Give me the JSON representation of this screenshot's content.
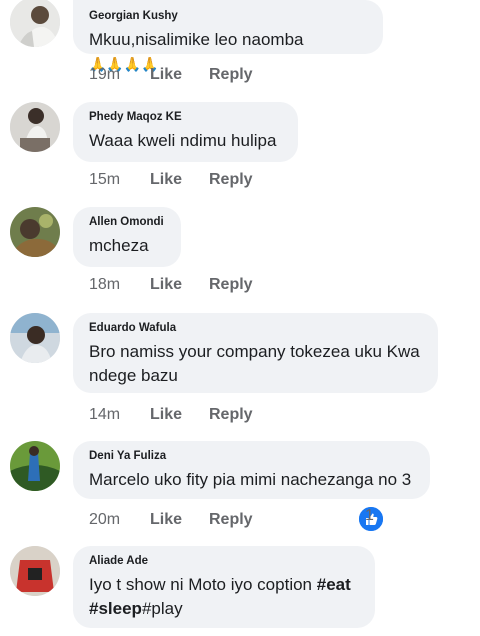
{
  "comments": [
    {
      "name": "Georgian Kushy",
      "text": "Mkuu,nisalimike leo naomba",
      "emoji": "🙏🙏🙏🙏",
      "time": "19m",
      "like_label": "Like",
      "reply_label": "Reply"
    },
    {
      "name": "Phedy Maqoz KE",
      "text": "Waaa kweli ndimu hulipa",
      "time": "15m",
      "like_label": "Like",
      "reply_label": "Reply"
    },
    {
      "name": "Allen Omondi",
      "text": "mcheza",
      "time": "18m",
      "like_label": "Like",
      "reply_label": "Reply"
    },
    {
      "name": "Eduardo Wafula",
      "text_line1": "Bro namiss your company tokezea uku Kwa",
      "text_line2": "ndege bazu",
      "time": "14m",
      "like_label": "Like",
      "reply_label": "Reply"
    },
    {
      "name": "Deni Ya Fuliza",
      "text": "Marcelo uko fity pia mimi nachezanga no 3",
      "time": "20m",
      "like_label": "Like",
      "reply_label": "Reply",
      "reaction_count": "1",
      "reaction_icon": "like-reaction-icon"
    },
    {
      "name": "Aliade Ade",
      "text_line1_plain": "Iyo t show ni Moto iyo coption ",
      "text_line1_tag": "#eat",
      "text_line2_tag": "#sleep",
      "text_line2_plain": "#play"
    }
  ],
  "colors": {
    "bubble": "#f0f2f5",
    "meta": "#65676b",
    "reaction_blue": "#1877f2"
  }
}
